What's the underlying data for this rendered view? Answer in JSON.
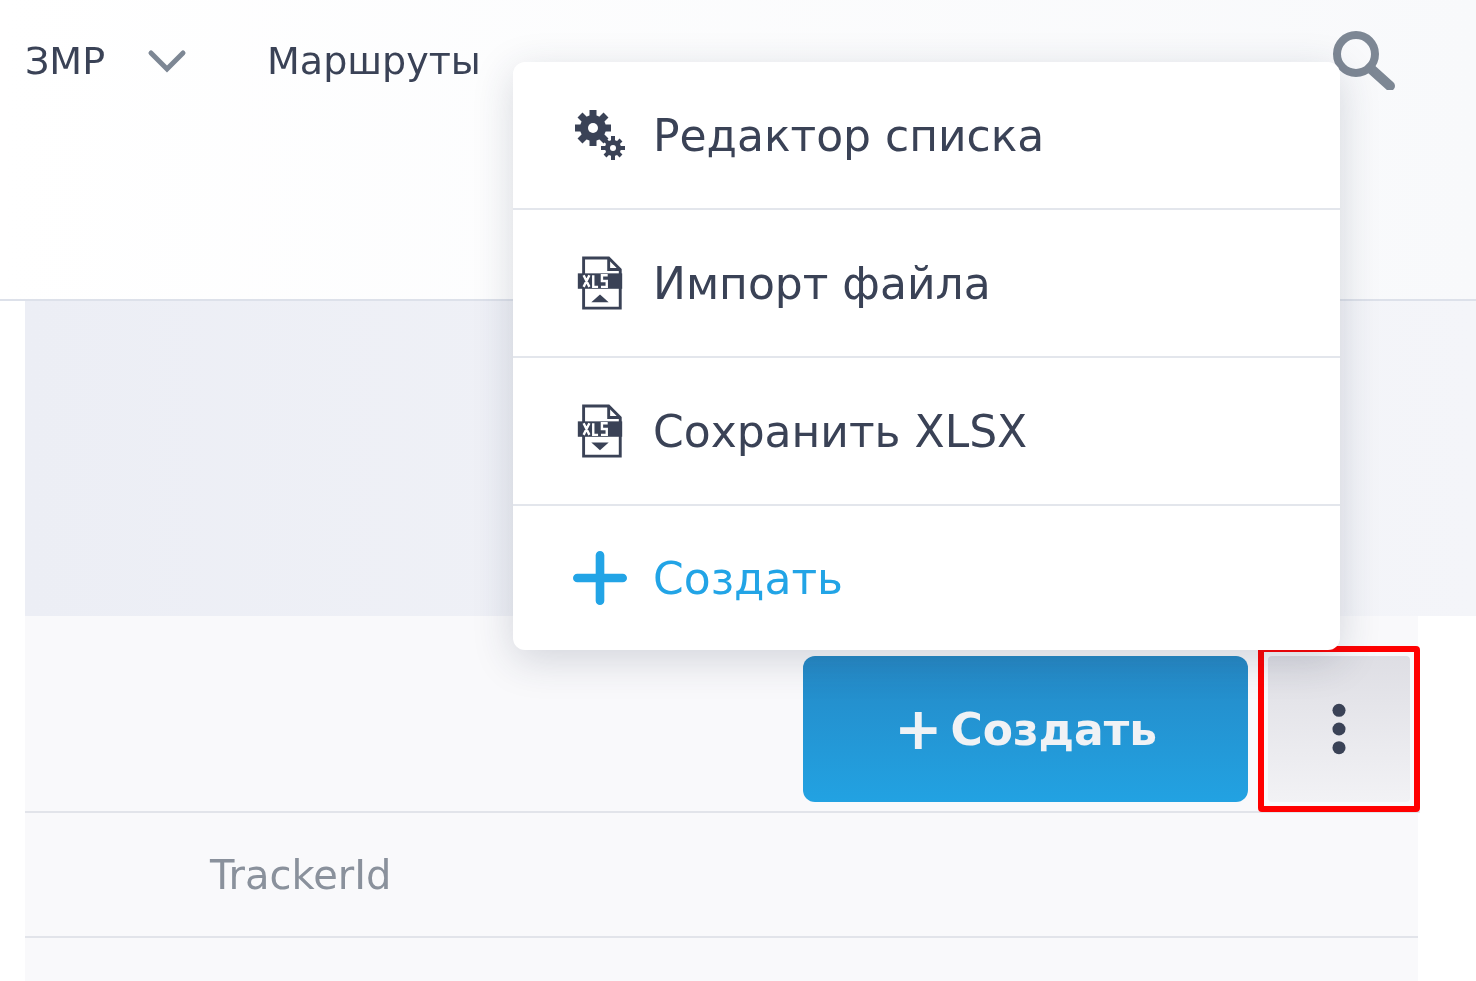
{
  "nav": [
    {
      "label": "ЗМР",
      "dropdown": true
    },
    {
      "label": "Маршруты",
      "dropdown": false
    }
  ],
  "menu": [
    {
      "kind": "settings",
      "label": "Редактор списка"
    },
    {
      "kind": "import",
      "label": "Импорт файла"
    },
    {
      "kind": "export",
      "label": "Сохранить XLSX"
    },
    {
      "kind": "create",
      "label": "Создать"
    }
  ],
  "toolbar": {
    "create_button": {
      "icon": "+",
      "label": "Создать"
    },
    "more_button": {
      "highlighted": true
    }
  },
  "table": {
    "columns": [
      "TrackerId"
    ]
  }
}
